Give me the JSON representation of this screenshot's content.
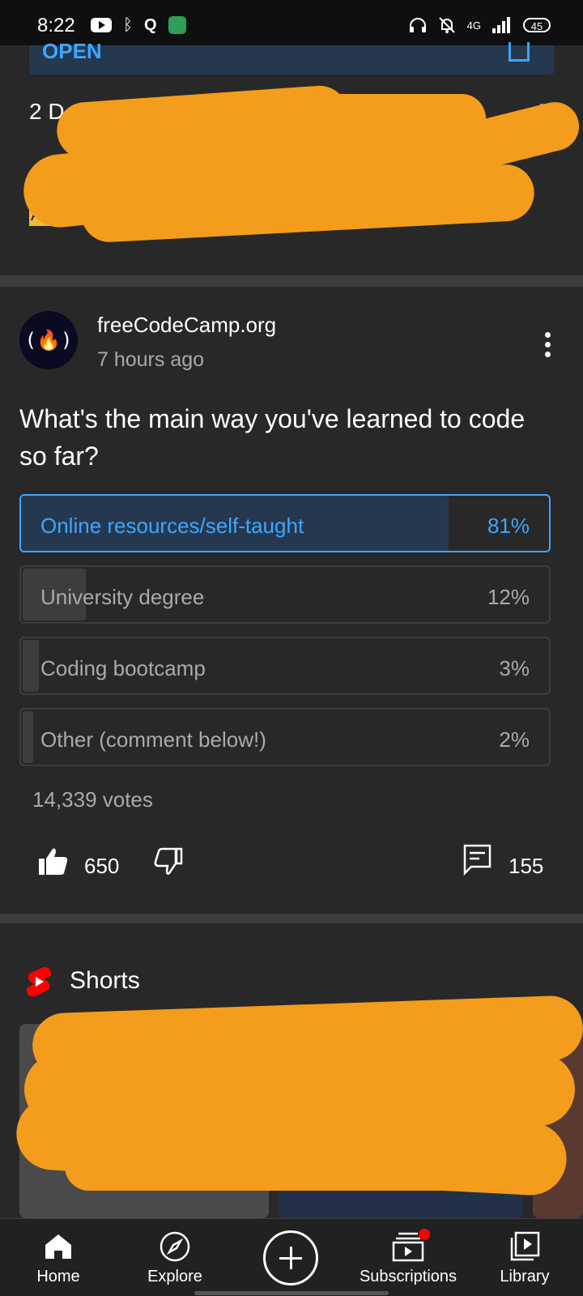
{
  "status_bar": {
    "time": "8:22",
    "network": "4G",
    "battery": "45",
    "icons_left": [
      "youtube-icon",
      "bluetooth-icon",
      "q-icon",
      "shield-app-icon"
    ],
    "icons_right": [
      "headphones-icon",
      "bell-off-icon",
      "signal-icon",
      "battery-icon"
    ]
  },
  "ad": {
    "open_label": "OPEN",
    "title": "2 D",
    "badge": "Ad",
    "redacted": true
  },
  "post": {
    "avatar_text": "(🔥)",
    "channel": "freeCodeCamp.org",
    "time": "7 hours ago",
    "question": "What's the main way you've learned to code so far?",
    "poll": [
      {
        "label": "Online resources/self-taught",
        "pct": "81%",
        "value": 81,
        "selected": true
      },
      {
        "label": "University degree",
        "pct": "12%",
        "value": 12,
        "selected": false
      },
      {
        "label": "Coding bootcamp",
        "pct": "3%",
        "value": 3,
        "selected": false
      },
      {
        "label": "Other (comment below!)",
        "pct": "2%",
        "value": 2,
        "selected": false
      }
    ],
    "votes": "14,339 votes",
    "likes": "650",
    "comments": "155"
  },
  "shorts": {
    "title": "Shorts",
    "redacted": true
  },
  "nav": {
    "home": "Home",
    "explore": "Explore",
    "subscriptions": "Subscriptions",
    "library": "Library"
  },
  "colors": {
    "background": "#282828",
    "accent": "#3ea6ff",
    "redaction": "#f49c1c",
    "ad_badge": "#f5b83a",
    "shorts_red": "#ff0000"
  }
}
